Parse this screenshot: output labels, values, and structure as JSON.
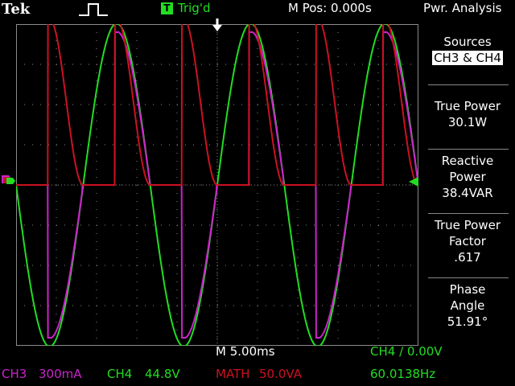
{
  "header": {
    "brand": "Tek",
    "trigger_mode_icon": "pulse-waveform-icon",
    "trigger_indicator": "T",
    "trigger_status": "Trig'd",
    "horizontal_position": "M Pos: 0.000s",
    "menu_title": "Pwr. Analysis"
  },
  "side_menu": {
    "sources": {
      "label": "Sources",
      "value": "CH3 & CH4"
    },
    "true_power": {
      "label": "True Power",
      "value": "30.1W"
    },
    "reactive_power": {
      "label_line1": "Reactive",
      "label_line2": "Power",
      "value": "38.4VAR"
    },
    "power_factor": {
      "label_line1": "True Power",
      "label_line2": "Factor",
      "value": ".617"
    },
    "phase_angle": {
      "label_line1": "Phase",
      "label_line2": "Angle",
      "value": "51.91°"
    }
  },
  "footer": {
    "timebase": "M 5.00ms",
    "trigger_setting": "CH4 ∕ 0.00V",
    "ch3_label": "CH3",
    "ch3_scale": "300mA",
    "ch4_label": "CH4",
    "ch4_scale": "44.8V",
    "math_label": "MATH",
    "math_scale": "50.0VA",
    "frequency": "60.0138Hz"
  },
  "colors": {
    "ch3": "#cc22cc",
    "ch4": "#22dd22",
    "math": "#cc1122",
    "grid": "#8a8a8a"
  },
  "scope": {
    "ch4_voltage_sine": {
      "unit": "V",
      "peak": 180,
      "frequency": 60.0138,
      "phase": "sine rising at 0.000s"
    },
    "ch3_current": {
      "unit": "mA",
      "peak": 1140,
      "conduction_angle_deg": 95
    },
    "math_instantaneous_power": {
      "unit": "VA",
      "peak": 200
    },
    "horizontal_divisions": 10,
    "vertical_divisions": 8,
    "time_per_div": 0.005
  }
}
